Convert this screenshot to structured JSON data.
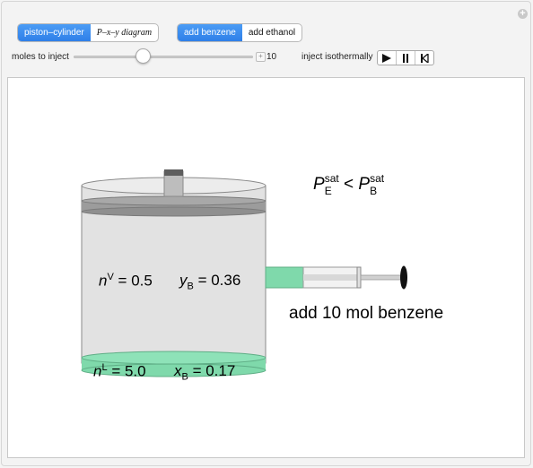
{
  "controls": {
    "view_tabs": [
      "piston–cylinder",
      "P–x–y diagram"
    ],
    "component_tabs": [
      "add benzene",
      "add ethanol"
    ],
    "moles_label": "moles to inject",
    "moles_value": "10",
    "moles_slider_fraction": 0.37,
    "inject_label": "inject isothermally"
  },
  "diagram": {
    "vapor_moles": "0.5",
    "vapor_frac": "0.36",
    "liquid_moles": "5.0",
    "liquid_frac": "0.17",
    "comparison_sym": "<",
    "caption": "add 10 mol benzene",
    "colors": {
      "liquid": "#7fd9ab",
      "cylinder": "#e2e2e2",
      "piston": "#9c9c9c",
      "active_tab": "#2f7fe8"
    }
  }
}
